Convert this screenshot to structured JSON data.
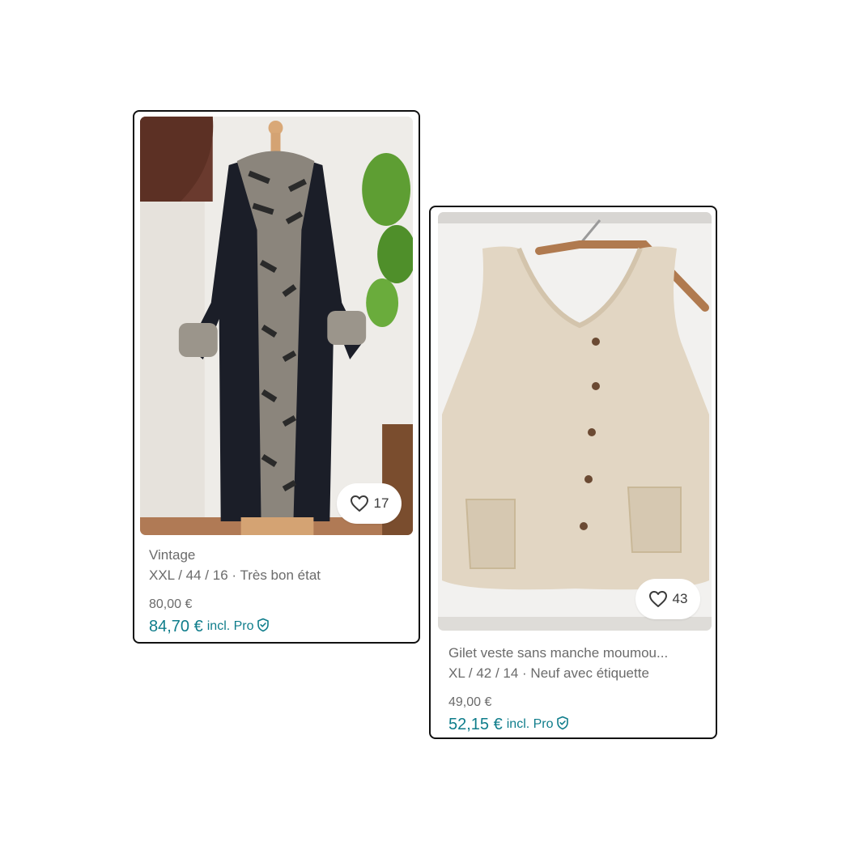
{
  "items": [
    {
      "title": "Vintage",
      "meta": "XXL / 44 / 16 · Très bon état",
      "price": "80,00 €",
      "pro_price": "84,70 €",
      "pro_label": "incl. Pro",
      "favorites": "17",
      "image": "long black suede coat with fur collar on mannequin"
    },
    {
      "title": "Gilet veste sans manche moumou...",
      "meta": "XL / 42 / 14 · Neuf avec étiquette",
      "price": "49,00 €",
      "pro_price": "52,15 €",
      "pro_label": "incl. Pro",
      "favorites": "43",
      "image": "beige sherpa sleeveless vest on wooden hanger"
    }
  ],
  "colors": {
    "accent": "#0f7d8b",
    "muted_text": "#6b6b6b",
    "card_border": "#111111"
  },
  "icons": {
    "favorite": "heart-outline-icon",
    "pro": "shield-check-icon"
  }
}
